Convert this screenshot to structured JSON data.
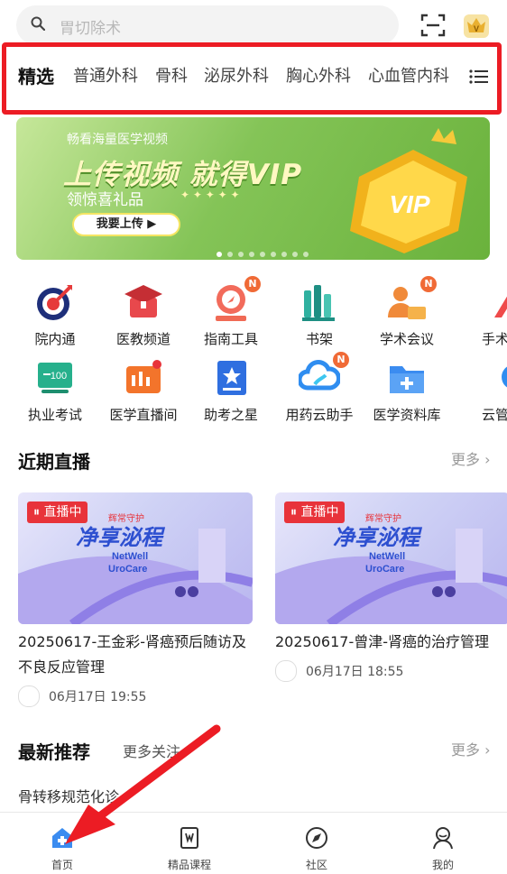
{
  "search": {
    "placeholder": "胃切除术"
  },
  "tabs": [
    "精选",
    "普通外科",
    "骨科",
    "泌尿外科",
    "胸心外科",
    "心血管内科"
  ],
  "banner": {
    "line1": "畅看海量医学视频",
    "headline": "上传视频 就得VIP",
    "line3": "领惊喜礼品",
    "stars": "✦ ✦ ✦ ✦ ✦",
    "button": "我要上传 ▶",
    "vip_text": "VIP"
  },
  "grid": [
    {
      "label": "院内通",
      "icon": "target-icon",
      "badge": ""
    },
    {
      "label": "医教频道",
      "icon": "graduation-cap-icon",
      "badge": ""
    },
    {
      "label": "指南工具",
      "icon": "compass-icon",
      "badge": "N"
    },
    {
      "label": "书架",
      "icon": "bookshelf-icon",
      "badge": ""
    },
    {
      "label": "学术会议",
      "icon": "meeting-icon",
      "badge": "N"
    },
    {
      "label": "手术",
      "icon": "surgery-icon",
      "badge": ""
    },
    {
      "label": "执业考试",
      "icon": "exam-icon",
      "badge": ""
    },
    {
      "label": "医学直播间",
      "icon": "live-studio-icon",
      "badge": ""
    },
    {
      "label": "助考之星",
      "icon": "star-book-icon",
      "badge": ""
    },
    {
      "label": "用药云助手",
      "icon": "cloud-icon",
      "badge": "N"
    },
    {
      "label": "医学资料库",
      "icon": "folder-plus-icon",
      "badge": ""
    },
    {
      "label": "云管",
      "icon": "cloud-manage-icon",
      "badge": ""
    }
  ],
  "recent_live": {
    "title": "近期直播",
    "more": "更多",
    "cards": [
      {
        "status": "直播中",
        "title": "20250617-王金彩-肾癌预后随访及不良反应管理",
        "time": "06月17日 19:55"
      },
      {
        "status": "直播中",
        "title": "20250617-曾津-肾癌的治疗管理",
        "time": "06月17日 18:55"
      }
    ],
    "thumb_text": {
      "tag": "辉常守护",
      "main": "净享泌程",
      "brand1": "NetWell",
      "brand2": "UroCare"
    }
  },
  "recommend": {
    "title": "最新推荐",
    "follow": "更多关注",
    "more": "更多",
    "first_item": "骨转移规范化诊"
  },
  "bottom_nav": [
    "首页",
    "精品课程",
    "社区",
    "我的"
  ],
  "colors": {
    "accent": "#3b8cf0",
    "live_red": "#e8333a",
    "highlight_red": "#ec1c24",
    "green": "#7abf4c"
  }
}
